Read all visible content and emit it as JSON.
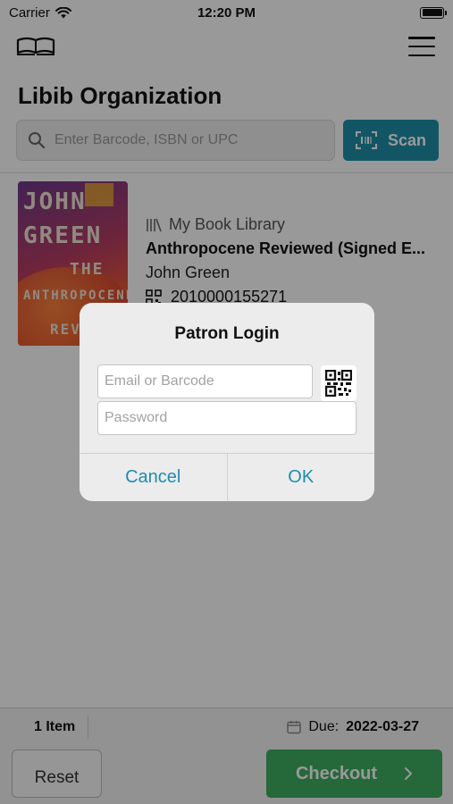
{
  "status_bar": {
    "carrier": "Carrier",
    "time": "12:20 PM"
  },
  "header": {
    "logo_icon": "open-book-icon",
    "menu_icon": "hamburger-menu-icon"
  },
  "organization": {
    "title": "Libib Organization"
  },
  "search": {
    "placeholder": "Enter Barcode, ISBN or UPC",
    "scan_label": "Scan"
  },
  "book": {
    "library": "My Book Library",
    "title": "Anthropocene Reviewed (Signed E...",
    "author": "John Green",
    "barcode": "2010000155271",
    "cover_lines": [
      "JOHN",
      "GREEN",
      "THE",
      "ANTHROPOCENE",
      "REVI"
    ]
  },
  "bottom": {
    "item_count": "1 Item",
    "due_label": "Due:",
    "due_date": "2022-03-27",
    "reset_label": "Reset",
    "checkout_label": "Checkout"
  },
  "dialog": {
    "title": "Patron Login",
    "email_placeholder": "Email or Barcode",
    "password_placeholder": "Password",
    "cancel_label": "Cancel",
    "ok_label": "OK"
  },
  "colors": {
    "scan_button": "#1e90aa",
    "checkout_button": "#3fae62",
    "dialog_link": "#1f8cb0",
    "overlay": "rgba(0,0,0,0.40)"
  }
}
